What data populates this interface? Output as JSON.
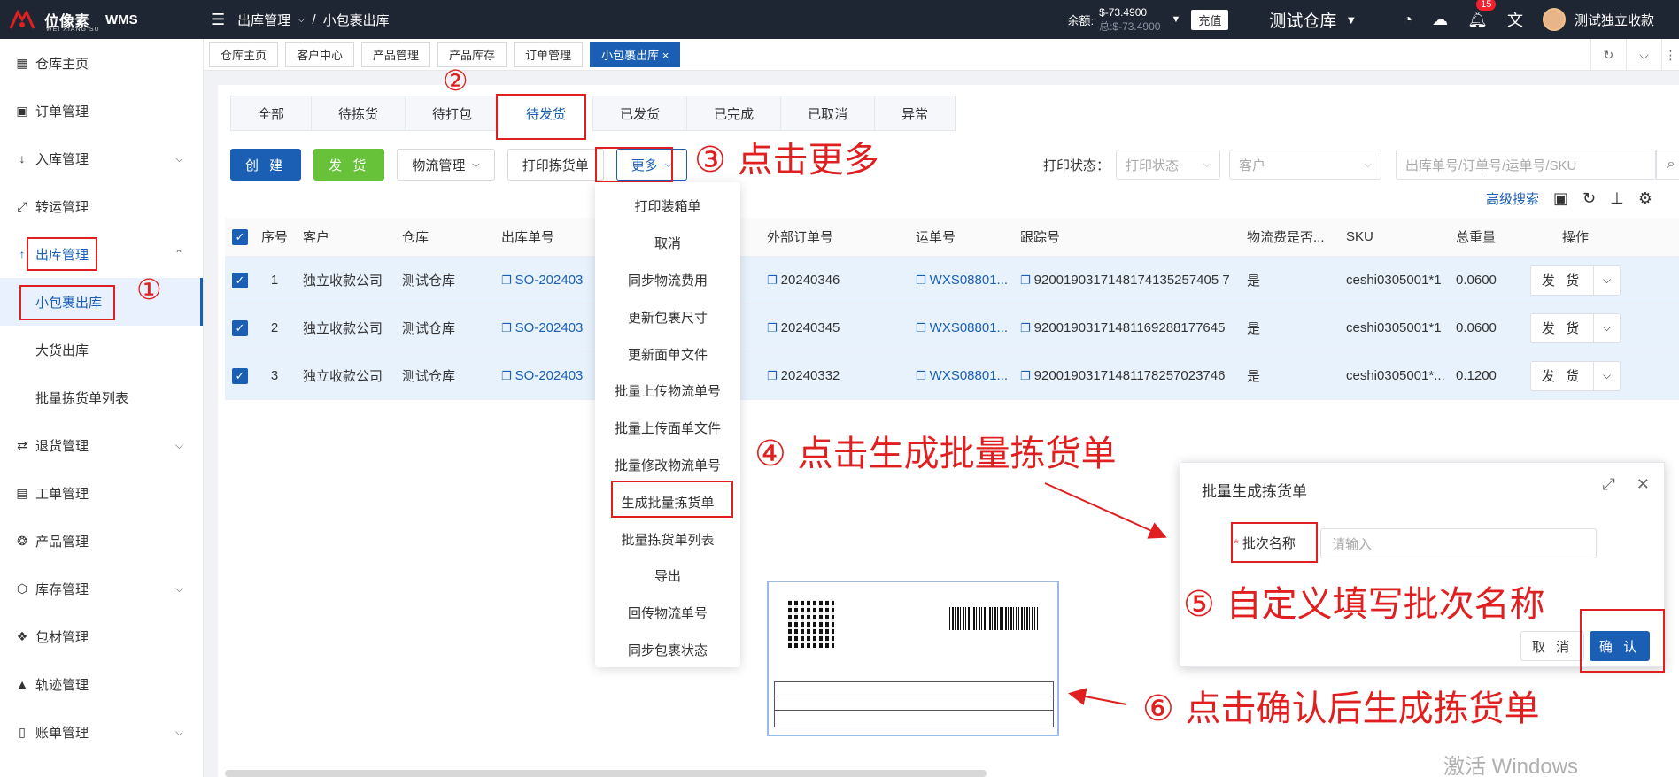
{
  "app": {
    "logo_text": "位像素",
    "logo_sub": "WEI XIANG SU",
    "product": "WMS",
    "breadcrumb": [
      "出库管理",
      "小包裹出库"
    ],
    "balance_label": "余额:",
    "balance": "$-73.4900",
    "balance_total": "总:$-73.4900",
    "recharge": "充值",
    "warehouse": "测试仓库",
    "notification_count": "15",
    "user": "测试独立收款"
  },
  "sidebar": {
    "items": [
      {
        "label": "仓库主页",
        "icon": "grid-icon"
      },
      {
        "label": "订单管理",
        "icon": "order-icon"
      },
      {
        "label": "入库管理",
        "icon": "arrow-down-icon"
      },
      {
        "label": "转运管理",
        "icon": "transfer-icon"
      },
      {
        "label": "出库管理",
        "icon": "arrow-up-icon"
      },
      {
        "label": "退货管理",
        "icon": "return-icon"
      },
      {
        "label": "工单管理",
        "icon": "workorder-icon"
      },
      {
        "label": "产品管理",
        "icon": "product-icon"
      },
      {
        "label": "库存管理",
        "icon": "box-icon"
      },
      {
        "label": "包材管理",
        "icon": "package-icon"
      },
      {
        "label": "轨迹管理",
        "icon": "track-icon"
      },
      {
        "label": "账单管理",
        "icon": "bill-icon"
      }
    ],
    "sub_items": [
      "小包裹出库",
      "大货出库",
      "批量拣货单列表"
    ]
  },
  "page_tabs": [
    "仓库主页",
    "客户中心",
    "产品管理",
    "产品库存",
    "订单管理",
    "小包裹出库 ×"
  ],
  "status_tabs": [
    "全部",
    "待拣货",
    "待打包",
    "待发货",
    "已发货",
    "已完成",
    "已取消",
    "异常"
  ],
  "toolbar": {
    "create": "创 建",
    "ship": "发 货",
    "logistics": "物流管理",
    "print_pick": "打印拣货单",
    "more": "更多",
    "print_status_label": "打印状态：",
    "print_status_placeholder": "打印状态",
    "customer_placeholder": "客户",
    "search_placeholder": "出库单号/订单号/运单号/SKU",
    "advanced_search": "高级搜索"
  },
  "table": {
    "headers": [
      "序号",
      "客户",
      "仓库",
      "出库单号",
      "外部订单号",
      "运单号",
      "跟踪号",
      "物流费是否...",
      "SKU",
      "总重量",
      "操作"
    ],
    "rows": [
      {
        "idx": "1",
        "customer": "独立收款公司",
        "warehouse": "测试仓库",
        "so": "SO-202403",
        "ext": "20240346",
        "waybill": "WXS08801...",
        "tracking": "9200190317148174135257405 7",
        "fee": "是",
        "sku": "ceshi0305001*1",
        "weight": "0.0600 *",
        "op": "发 货"
      },
      {
        "idx": "2",
        "customer": "独立收款公司",
        "warehouse": "测试仓库",
        "so": "SO-202403",
        "ext": "20240345",
        "waybill": "WXS08801...",
        "tracking": "92001903171481169288177645",
        "fee": "是",
        "sku": "ceshi0305001*1",
        "weight": "0.0600 *",
        "op": "发 货"
      },
      {
        "idx": "3",
        "customer": "独立收款公司",
        "warehouse": "测试仓库",
        "so": "SO-202403",
        "ext": "20240332",
        "waybill": "WXS08801...",
        "tracking": "92001903171481178257023746",
        "fee": "是",
        "sku": "ceshi0305001*...",
        "weight": "0.1200 *",
        "op": "发 货"
      }
    ]
  },
  "dropdown": [
    "打印装箱单",
    "取消",
    "同步物流费用",
    "更新包裹尺寸",
    "更新面单文件",
    "批量上传物流单号",
    "批量上传面单文件",
    "批量修改物流单号",
    "生成批量拣货单",
    "批量拣货单列表",
    "导出",
    "回传物流单号",
    "同步包裹状态"
  ],
  "dialog": {
    "title": "批量生成拣货单",
    "label": "批次名称",
    "required_mark": "*",
    "placeholder": "请输入",
    "cancel": "取 消",
    "confirm": "确 认"
  },
  "annotations": {
    "a1": "①",
    "a2": "②",
    "a3": "③ 点击更多",
    "a4": "④ 点击生成批量拣货单",
    "a5": "⑤ 自定义填写批次名称",
    "a6": "⑥ 点击确认后生成拣货单"
  },
  "watermark": "激活 Windows"
}
